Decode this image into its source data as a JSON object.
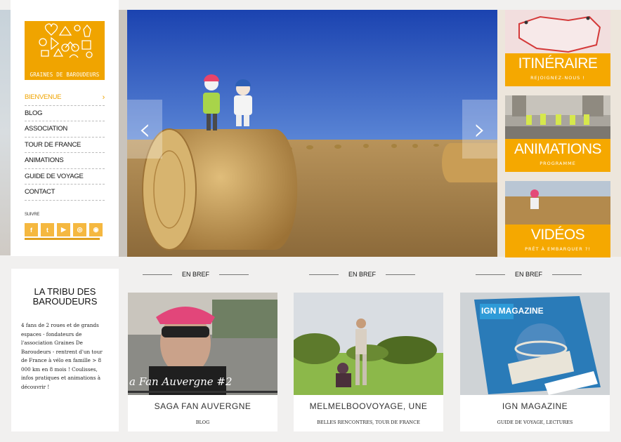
{
  "brand": {
    "name": "GRAINES DE BAROUDEURS"
  },
  "nav": {
    "items": [
      {
        "label": "BIENVENUE",
        "active": true
      },
      {
        "label": "BLOG"
      },
      {
        "label": "ASSOCIATION"
      },
      {
        "label": "TOUR DE FRANCE"
      },
      {
        "label": "ANIMATIONS"
      },
      {
        "label": "GUIDE DE VOYAGE"
      },
      {
        "label": "CONTACT"
      }
    ],
    "chevron": "›"
  },
  "social": {
    "label": "SUIVRE",
    "icons": [
      "facebook-icon",
      "twitter-icon",
      "youtube-icon",
      "instagram-icon",
      "rss-icon"
    ],
    "glyphs": [
      "f",
      "t",
      "▶",
      "◎",
      "◉"
    ]
  },
  "hero": {
    "prev": "‹",
    "next": "›"
  },
  "tiles": [
    {
      "title": "ITINÉRAIRE",
      "subtitle": "REJOIGNEZ-NOUS !"
    },
    {
      "title": "ANIMATIONS",
      "subtitle": "PROGRAMME"
    },
    {
      "title": "VIDÉOS",
      "subtitle": "PRÊT À EMBARQUER ?!"
    }
  ],
  "tribe": {
    "title": "LA TRIBU DES BAROUDEURS",
    "text": "4 fans de 2 roues et de grands espaces - fondateurs de l'association Graines De Baroudeurs - rentrent d'un tour de France à vélo en famille > 8 000 km en 8 mois ! Coulisses, infos pratiques et animations à découvrir !"
  },
  "bref": [
    {
      "heading": "EN BREF",
      "title": "SAGA FAN AUVERGNE",
      "category": "BLOG",
      "overlay": "a Fan Auvergne #2"
    },
    {
      "heading": "EN BREF",
      "title": "MELMELBOOVOYAGE, UNE",
      "category": "BELLES RENCONTRES, TOUR DE FRANCE"
    },
    {
      "heading": "EN BREF",
      "title": "IGN MAGAZINE",
      "category": "GUIDE DE VOYAGE, LECTURES",
      "overlay": "IGN MAGAZINE"
    }
  ],
  "colors": {
    "accent": "#f5a800",
    "logo": "#f0a400",
    "sky": "#1f4fb8",
    "straw": "#c49a52"
  }
}
